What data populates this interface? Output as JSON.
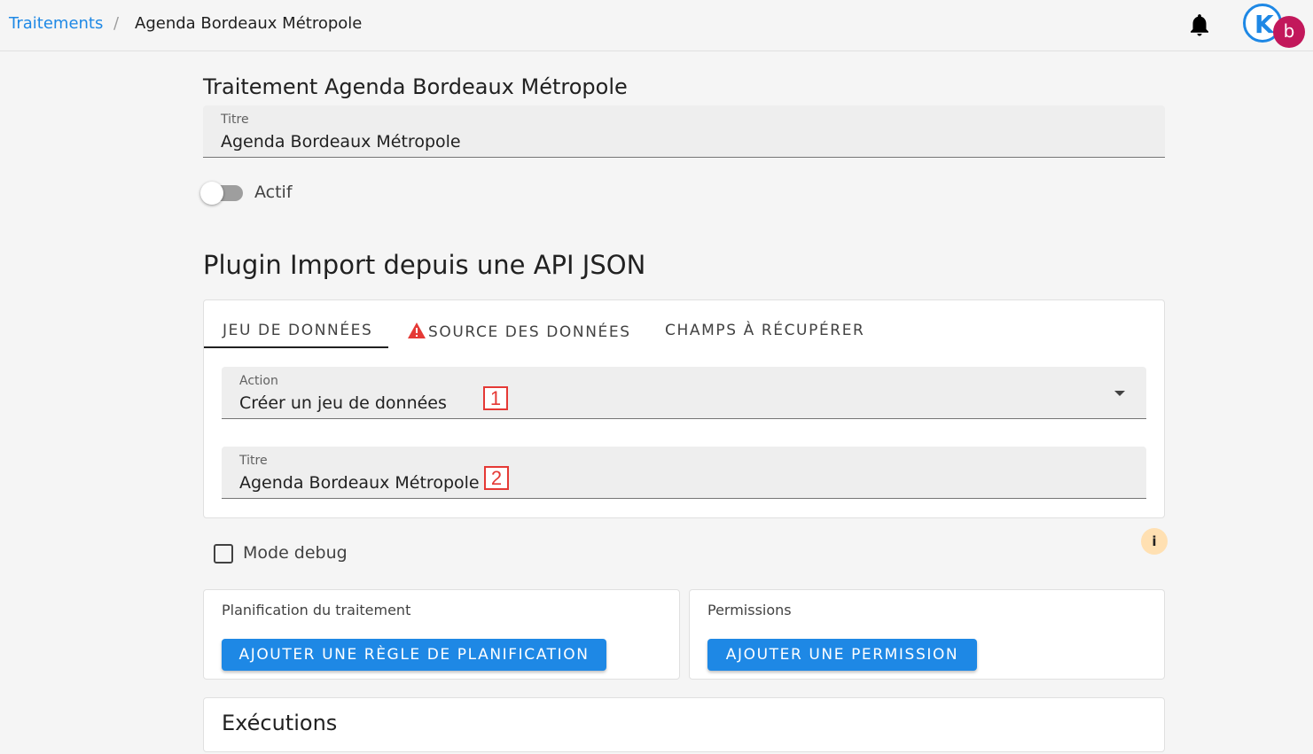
{
  "breadcrumb": {
    "link": "Traitements",
    "separator": "/",
    "current": "Agenda Bordeaux Métropole"
  },
  "header": {
    "notification_icon": "bell-icon",
    "avatar_letter": "b",
    "logo_letter": "K"
  },
  "processing": {
    "title": "Traitement Agenda Bordeaux Métropole",
    "title_field": {
      "label": "Titre",
      "value": "Agenda Bordeaux Métropole"
    },
    "active_toggle": {
      "label": "Actif",
      "checked": false
    }
  },
  "plugin": {
    "title": "Plugin Import depuis une API JSON",
    "tabs": [
      {
        "label": "JEU DE DONNÉES",
        "active": true
      },
      {
        "label": "SOURCE DES DONNÉES",
        "warning": true
      },
      {
        "label": "CHAMPS À RÉCUPÉRER"
      }
    ],
    "action_field": {
      "label": "Action",
      "value": "Créer un jeu de données",
      "marker": "1"
    },
    "dataset_title_field": {
      "label": "Titre",
      "value": "Agenda Bordeaux Métropole",
      "marker": "2"
    }
  },
  "debug": {
    "label": "Mode debug",
    "checked": false,
    "info_icon": "i"
  },
  "scheduling": {
    "heading": "Planification du traitement",
    "button": "AJOUTER UNE RÈGLE DE PLANIFICATION"
  },
  "permissions": {
    "heading": "Permissions",
    "button": "AJOUTER UNE PERMISSION"
  },
  "executions": {
    "heading": "Exécutions"
  },
  "colors": {
    "primary": "#1e88e5",
    "avatar": "#c2185b",
    "warning": "#e53935",
    "info_bg": "#ffe0b2"
  }
}
